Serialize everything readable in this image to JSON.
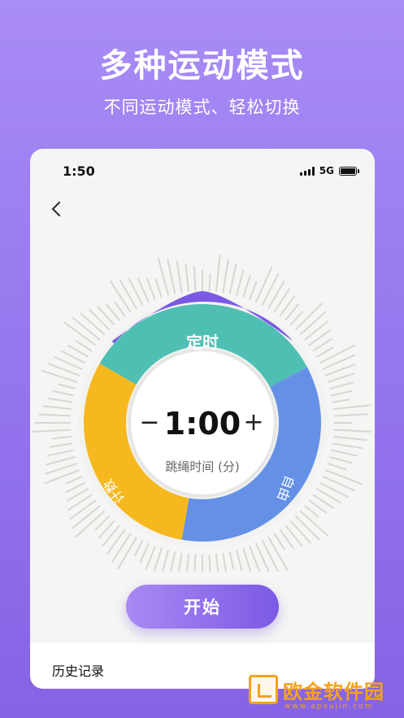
{
  "promo": {
    "title": "多种运动模式",
    "subtitle": "不同运动模式、轻松切换"
  },
  "status_bar": {
    "time": "1:50",
    "network": "5G"
  },
  "dial": {
    "modes": {
      "timed": "定时",
      "count": "计数",
      "free": "自由"
    },
    "minus_label": "−",
    "plus_label": "+",
    "timer_value": "1:00",
    "timer_unit": "跳绳时间 (分)"
  },
  "actions": {
    "start_label": "开始"
  },
  "history": {
    "label": "历史记录"
  },
  "watermark": {
    "text": "欧金软件园",
    "sub": "www.apoujin.com"
  },
  "colors": {
    "background": "#9679ee",
    "timed_segment": "#4fbfb4",
    "count_segment": "#f6b81f",
    "free_segment": "#6490e6",
    "accent": "#7b59e4"
  }
}
